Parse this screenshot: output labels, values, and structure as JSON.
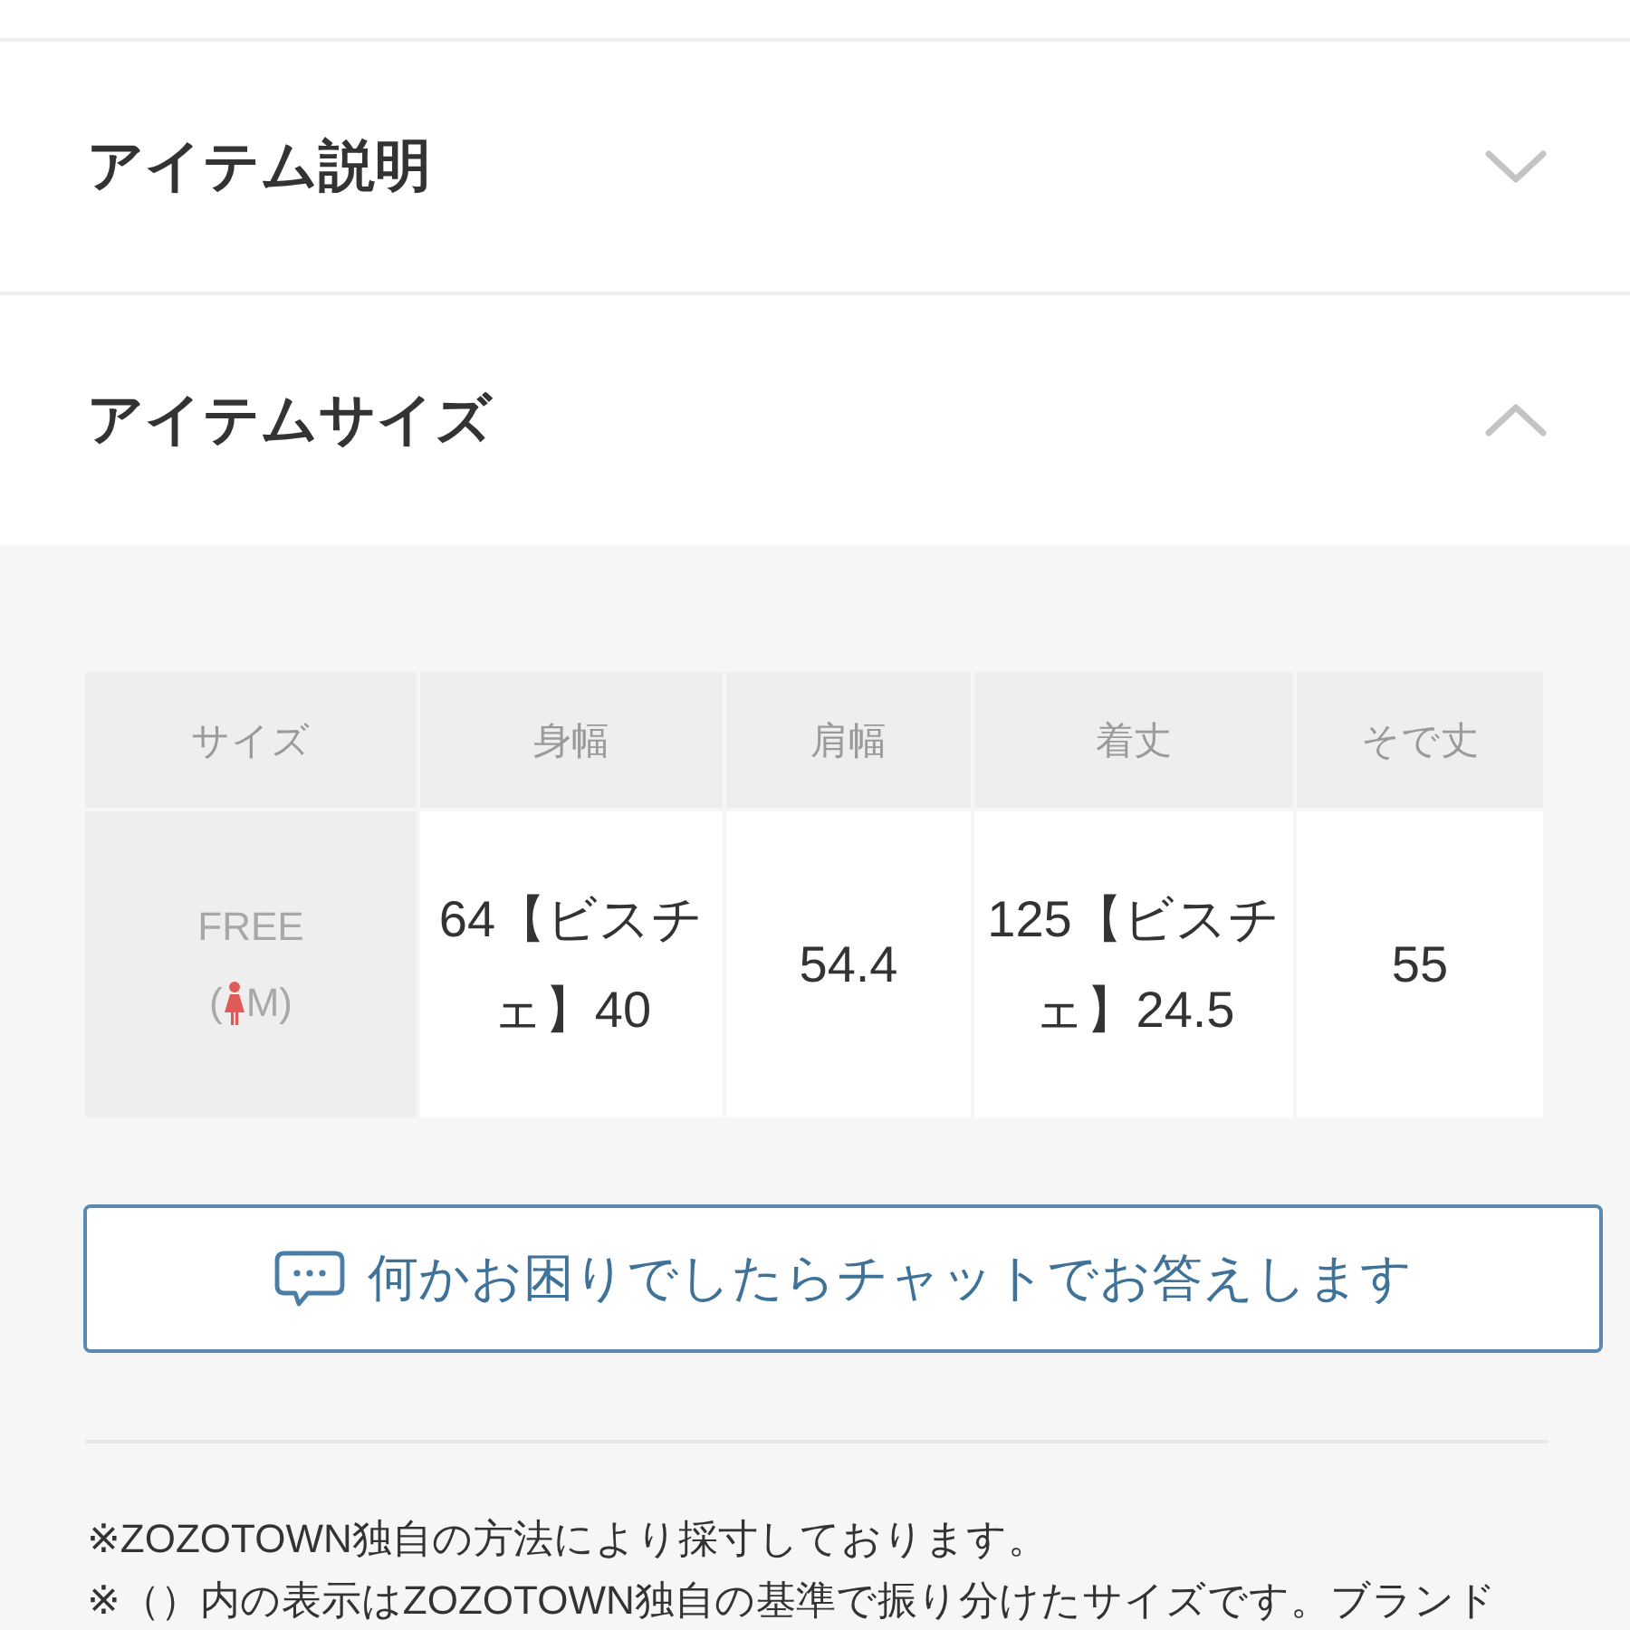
{
  "sections": [
    {
      "title": "アイテム説明",
      "expanded": false
    },
    {
      "title": "アイテムサイズ",
      "expanded": true,
      "size_table": {
        "columns": [
          "サイズ",
          "身幅",
          "肩幅",
          "着丈",
          "そで丈"
        ],
        "rows": [
          {
            "size": "FREE",
            "size_note_open": "(",
            "size_note_rest": "M)",
            "values": [
              "64【ビスチェ】40",
              "54.4",
              "125【ビスチェ】24.5",
              "55"
            ]
          }
        ]
      },
      "chat_button": {
        "label": "何かお困りでしたらチャットでお答えします"
      },
      "notes": [
        "※ZOZOTOWN独自の方法により採寸しております。",
        "※（）内の表示はZOZOTOWN独自の基準で振り分けたサイズです。ブランド"
      ]
    }
  ]
}
